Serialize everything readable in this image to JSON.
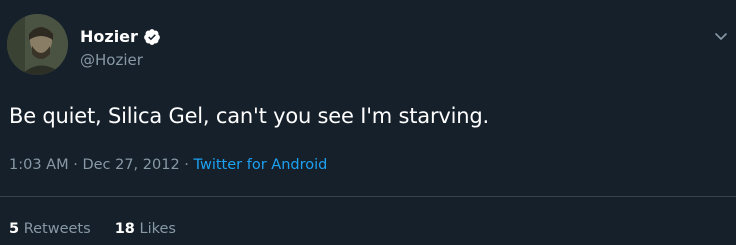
{
  "user": {
    "display_name": "Hozier",
    "handle": "@Hozier",
    "verified": true
  },
  "tweet": {
    "text": "Be quiet, Silica Gel, can't you see I'm starving.",
    "time": "1:03 AM",
    "separator": "·",
    "date": "Dec 27, 2012",
    "source": "Twitter for Android"
  },
  "stats": {
    "retweets_count": "5",
    "retweets_label": "Retweets",
    "likes_count": "18",
    "likes_label": "Likes"
  },
  "colors": {
    "background": "#15202b",
    "secondary_text": "#8899a6",
    "accent": "#1da1f2",
    "divider": "#38444d"
  },
  "icons": {
    "verified": "verified-badge-icon",
    "menu": "chevron-down-icon"
  }
}
